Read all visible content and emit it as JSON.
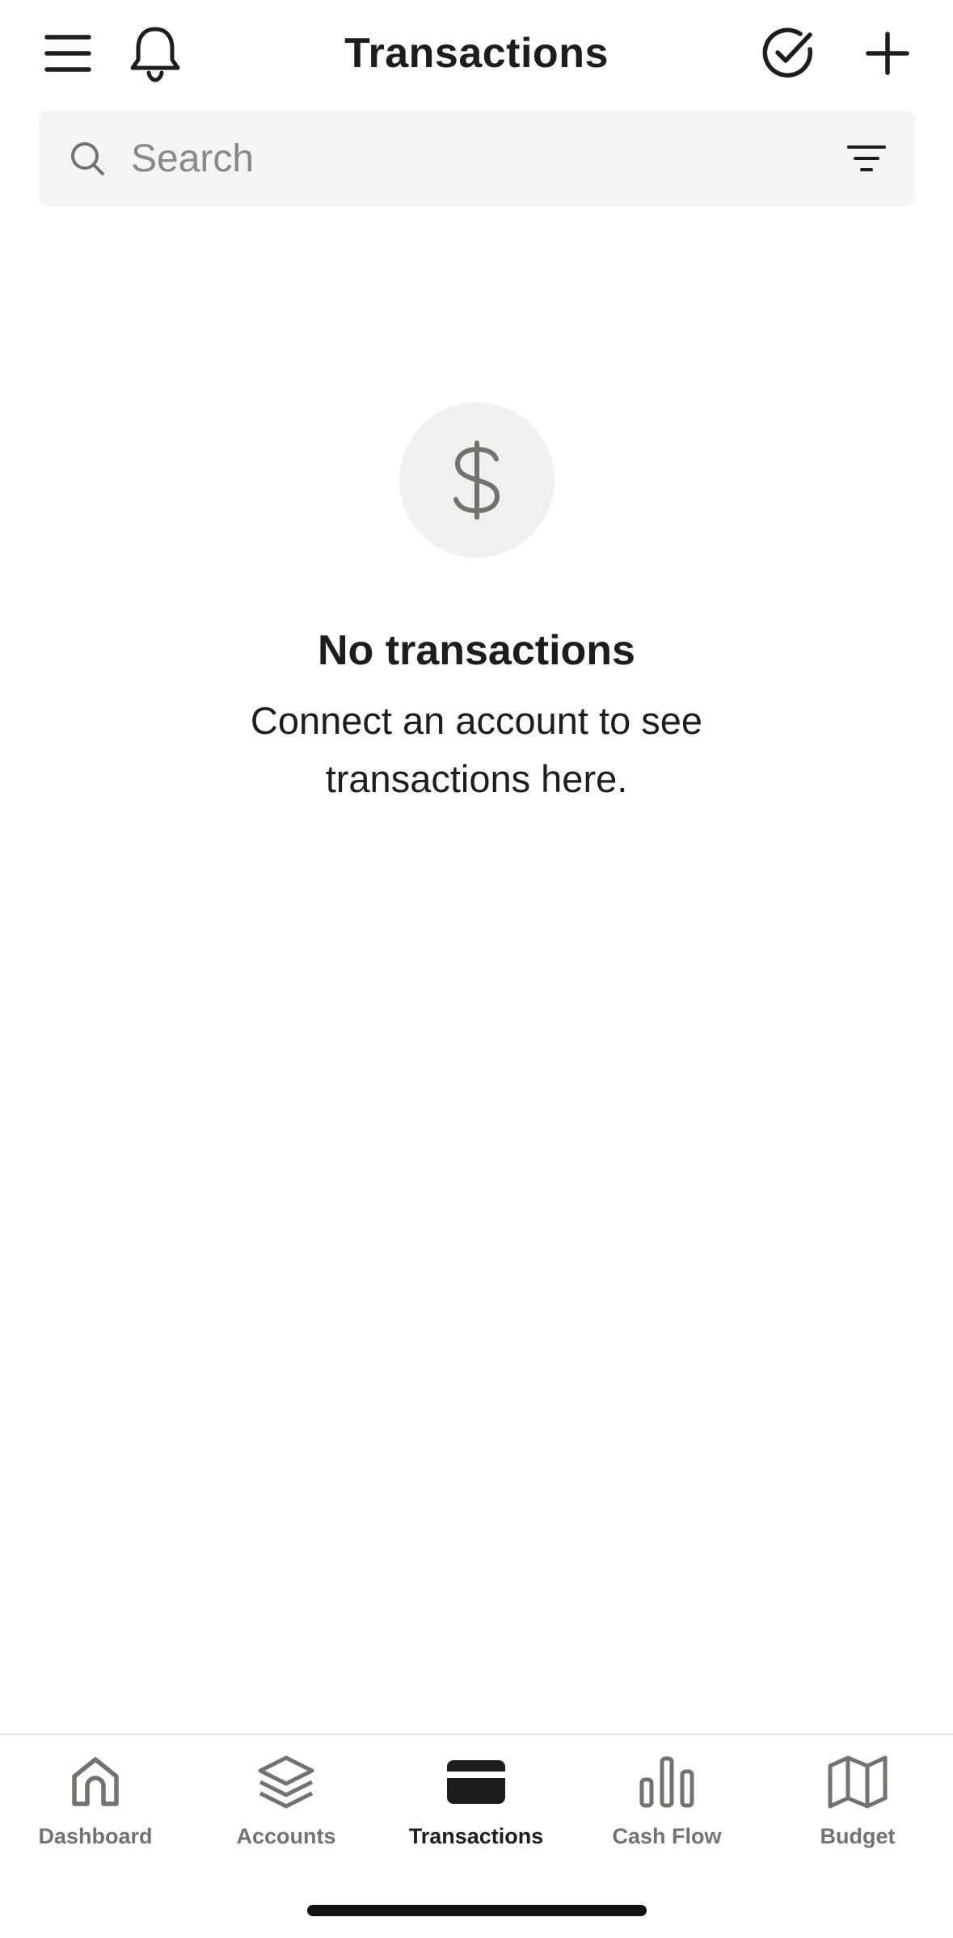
{
  "header": {
    "title": "Transactions",
    "left_icons": [
      "menu-icon",
      "bell-icon"
    ],
    "right_icons": [
      "check-circle-icon",
      "plus-icon"
    ]
  },
  "search": {
    "placeholder": "Search",
    "value": "",
    "filter_icon": "filter-icon"
  },
  "empty_state": {
    "icon": "dollar-icon",
    "title": "No transactions",
    "message": "Connect an account to see transactions here."
  },
  "tab_bar": {
    "active": "Transactions",
    "tabs": [
      {
        "label": "Dashboard",
        "icon": "home-icon"
      },
      {
        "label": "Accounts",
        "icon": "layers-icon"
      },
      {
        "label": "Transactions",
        "icon": "credit-card-icon"
      },
      {
        "label": "Cash Flow",
        "icon": "bar-chart-icon"
      },
      {
        "label": "Budget",
        "icon": "map-icon"
      }
    ]
  },
  "colors": {
    "text": "#1d1d1b",
    "muted": "#74726f",
    "search_bg": "#f5f4f2",
    "empty_circle_bg": "#f1f0ee",
    "divider": "#e3e2df"
  }
}
